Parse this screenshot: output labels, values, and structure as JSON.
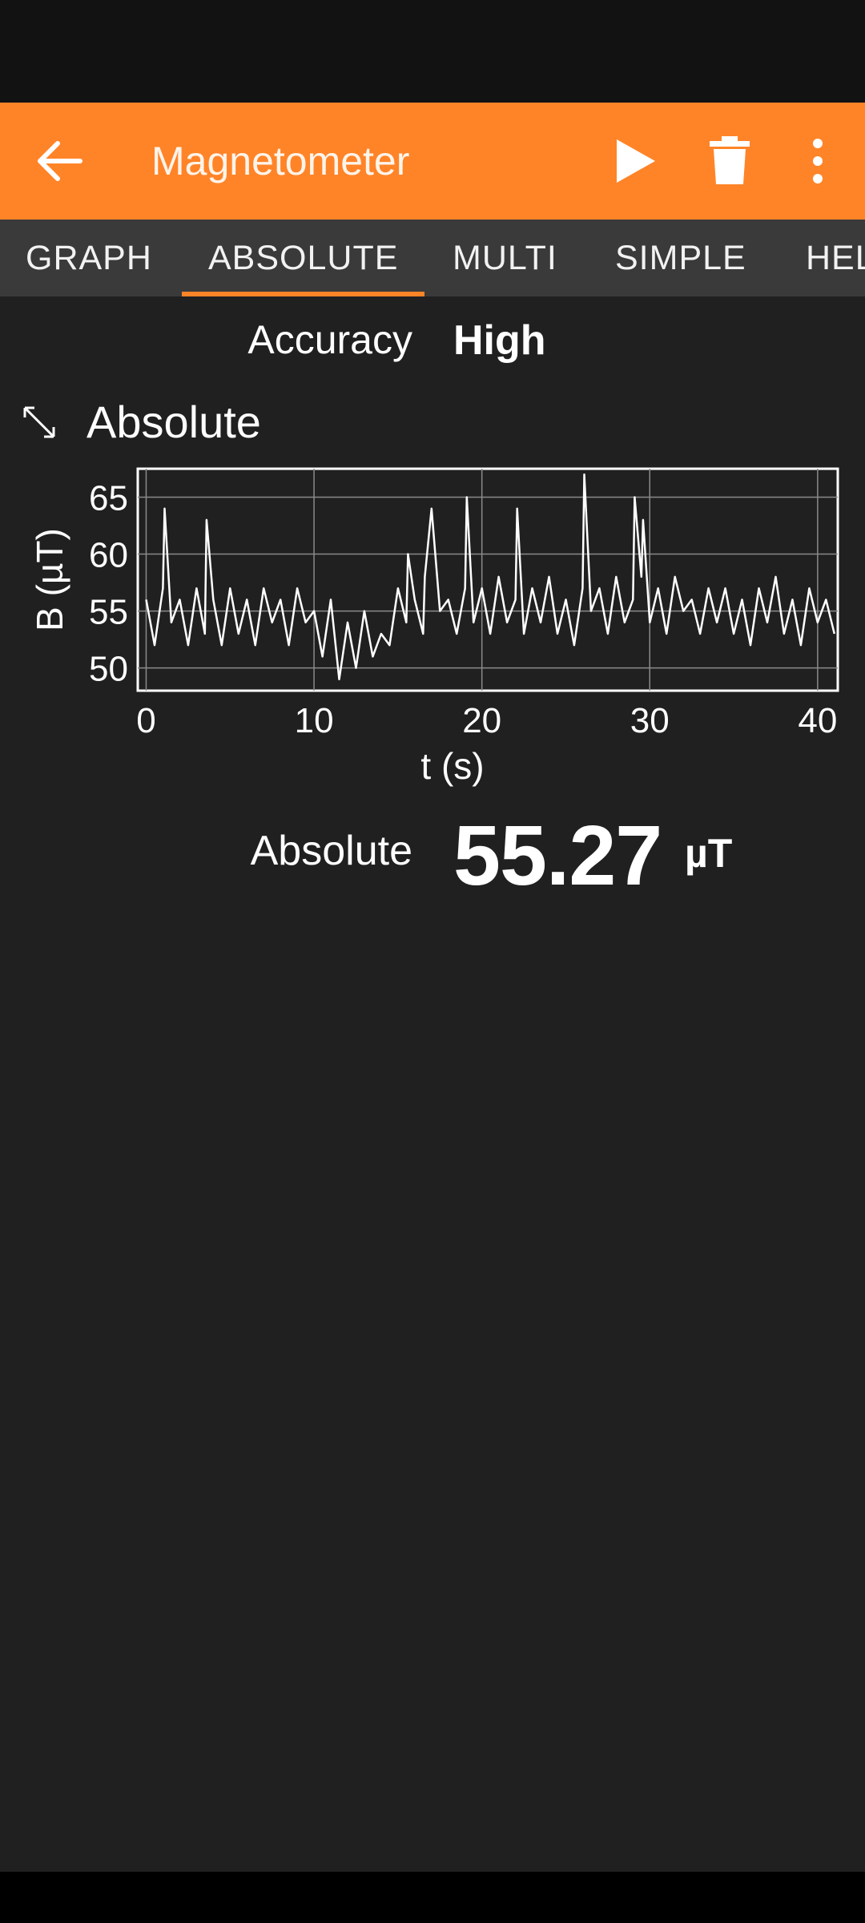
{
  "app": {
    "title": "Magnetometer"
  },
  "colors": {
    "accent": "#ff8428",
    "background": "#202020",
    "tab_bar": "#3a3a3a"
  },
  "toolbar": {
    "back_icon": "arrow-left-icon",
    "play_icon": "play-icon",
    "delete_icon": "trash-icon",
    "more_icon": "more-vert-icon"
  },
  "tabs": [
    {
      "label": "GRAPH",
      "active": false
    },
    {
      "label": "ABSOLUTE",
      "active": true
    },
    {
      "label": "MULTI",
      "active": false
    },
    {
      "label": "SIMPLE",
      "active": false
    },
    {
      "label": "HELP",
      "active": false
    }
  ],
  "accuracy": {
    "label": "Accuracy",
    "value": "High"
  },
  "graph": {
    "title": "Absolute",
    "expand_icon": "expand-icon"
  },
  "chart_data": {
    "type": "line",
    "title": "",
    "xlabel": "t (s)",
    "ylabel": "B (µT)",
    "xlim": [
      -0.5,
      41.2
    ],
    "ylim": [
      48,
      67.5
    ],
    "xticks": [
      0,
      10,
      20,
      30,
      40
    ],
    "yticks": [
      50,
      55,
      60,
      65
    ],
    "grid": true,
    "series": [
      {
        "x": [
          0,
          0.5,
          1,
          1.1,
          1.5,
          2,
          2.5,
          3,
          3.5,
          3.6,
          4,
          4.5,
          5,
          5.5,
          6,
          6.5,
          7,
          7.5,
          8,
          8.5,
          9,
          9.5,
          10,
          10.5,
          11,
          11.5,
          12,
          12.5,
          13,
          13.5,
          14,
          14.5,
          15,
          15.5,
          15.6,
          16,
          16.5,
          16.6,
          17,
          17.5,
          18,
          18.5,
          19,
          19.1,
          19.5,
          20,
          20.5,
          21,
          21.5,
          22,
          22.1,
          22.5,
          23,
          23.5,
          24,
          24.5,
          25,
          25.5,
          26,
          26.1,
          26.5,
          27,
          27.5,
          28,
          28.5,
          29,
          29.1,
          29.5,
          29.6,
          30,
          30.5,
          31,
          31.5,
          32,
          32.5,
          33,
          33.5,
          34,
          34.5,
          35,
          35.5,
          36,
          36.5,
          37,
          37.5,
          38,
          38.5,
          39,
          39.5,
          40,
          40.5,
          41
        ],
        "values": [
          56,
          52,
          57,
          64,
          54,
          56,
          52,
          57,
          53,
          63,
          56,
          52,
          57,
          53,
          56,
          52,
          57,
          54,
          56,
          52,
          57,
          54,
          55,
          51,
          56,
          49,
          54,
          50,
          55,
          51,
          53,
          52,
          57,
          54,
          60,
          56,
          53,
          58,
          64,
          55,
          56,
          53,
          57,
          65,
          54,
          57,
          53,
          58,
          54,
          56,
          64,
          53,
          57,
          54,
          58,
          53,
          56,
          52,
          57,
          67,
          55,
          57,
          53,
          58,
          54,
          56,
          65,
          58,
          63,
          54,
          57,
          53,
          58,
          55,
          56,
          53,
          57,
          54,
          57,
          53,
          56,
          52,
          57,
          54,
          58,
          53,
          56,
          52,
          57,
          54,
          56,
          53
        ]
      }
    ]
  },
  "result": {
    "label": "Absolute",
    "value": "55.27",
    "unit": "µT"
  }
}
